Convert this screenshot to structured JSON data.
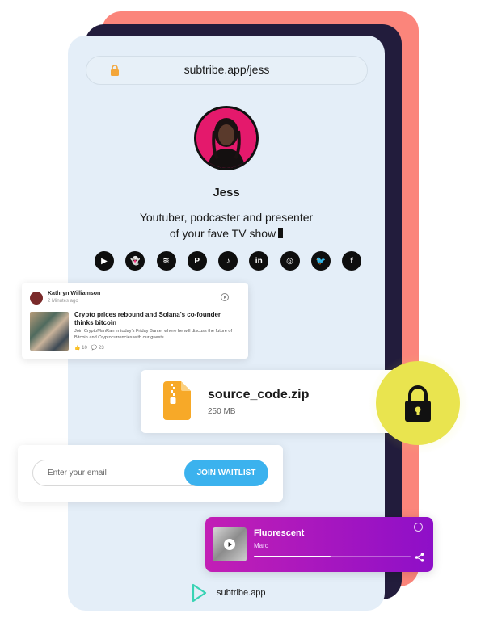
{
  "browser": {
    "url": "subtribe.app/jess"
  },
  "profile": {
    "name": "Jess",
    "bio_line1": "Youtuber, podcaster and presenter",
    "bio_line2": "of your fave TV show"
  },
  "socials": [
    {
      "icon": "youtube-icon",
      "glyph": "▶"
    },
    {
      "icon": "snapchat-icon",
      "glyph": "👻"
    },
    {
      "icon": "spotify-icon",
      "glyph": "≋"
    },
    {
      "icon": "pinterest-icon",
      "glyph": "P"
    },
    {
      "icon": "tiktok-icon",
      "glyph": "♪"
    },
    {
      "icon": "linkedin-icon",
      "glyph": "in"
    },
    {
      "icon": "instagram-icon",
      "glyph": "◎"
    },
    {
      "icon": "twitter-icon",
      "glyph": "🐦"
    },
    {
      "icon": "facebook-icon",
      "glyph": "f"
    }
  ],
  "post": {
    "author": "Kathryn Williamson",
    "time": "2 Minutes ago",
    "title": "Crypto prices rebound and Solana's co-founder thinks bitcoin",
    "excerpt": "Join CryptoManRan in today's Friday Banter where he will discuss the future of Bitcoin and Cryptocurrencies with our guests.",
    "likes": "10",
    "comments": "23"
  },
  "file": {
    "name": "source_code.zip",
    "size": "250 MB"
  },
  "waitlist": {
    "placeholder": "Enter your email",
    "button": "JOIN WAITLIST"
  },
  "player": {
    "track": "Fluorescent",
    "artist": "Marc",
    "progress": 0.49
  },
  "footer": {
    "text": "subtribe.app"
  },
  "colors": {
    "coral": "#fb857b",
    "navy": "#221c3c",
    "accent_blue": "#3bb2ee",
    "lock_yellow": "#e9e44f",
    "player_start": "#c21fb5",
    "player_end": "#8e0fc8",
    "avatar_pink": "#e4196c"
  }
}
